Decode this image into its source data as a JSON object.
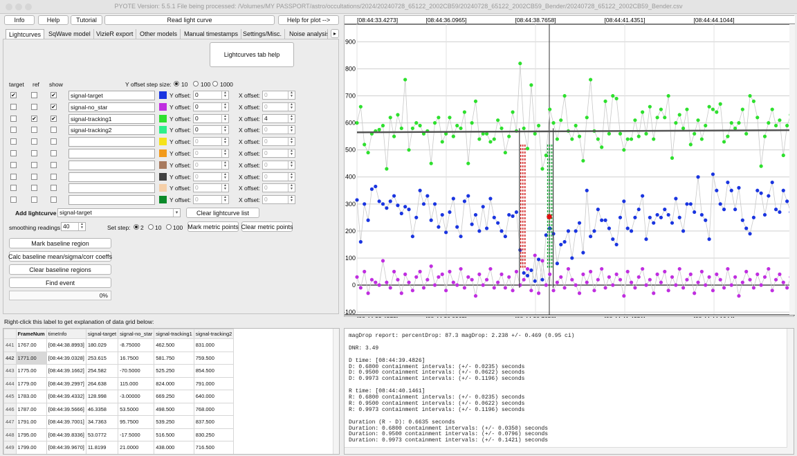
{
  "window": {
    "title": "PYOTE Version: 5.5.1  File being processed: /Volumes/MY PASSPORT/astro/occultations/2024/20240728_65122_2002CB59/20240728_65122_2002CB59_Bender/20240728_65122_2002CB59_Bender.csv"
  },
  "toolbar": {
    "info": "Info",
    "help": "Help",
    "tutorial": "Tutorial",
    "read_light_curve": "Read light curve",
    "help_for_plot": "Help for plot -->"
  },
  "tabs": [
    "Lightcurves",
    "SqWave model",
    "VizieR export",
    "Other models",
    "Manual timestamps",
    "Settings/Misc.",
    "Noise analysis/"
  ],
  "tab_scroll": "▸",
  "lc_tab": {
    "help_button": "Lightcurves tab help",
    "col_target": "target",
    "col_ref": "ref",
    "col_show": "show",
    "y_step_label": "Y offset step size:",
    "y_step_options": [
      "10",
      "100",
      "1000"
    ],
    "y_offset_label": "Y offset:",
    "x_offset_label": "X offset:",
    "rows": [
      {
        "name": "signal-target",
        "color": "#1a35e0",
        "target": "✔",
        "ref": "",
        "show": "✔",
        "y": "0",
        "x": "0"
      },
      {
        "name": "signal-no_star",
        "color": "#c02ee0",
        "target": "",
        "ref": "",
        "show": "✔",
        "y": "0",
        "x": "0"
      },
      {
        "name": "signal-tracking1",
        "color": "#2ee02e",
        "target": "",
        "ref": "✔",
        "show": "✔",
        "y": "0",
        "x": "4"
      },
      {
        "name": "signal-tracking2",
        "color": "#2ef08a",
        "target": "",
        "ref": "",
        "show": "",
        "y": "0",
        "x": "0"
      },
      {
        "name": "",
        "color": "#f5e21a",
        "target": "",
        "ref": "",
        "show": "",
        "y": "0",
        "x": "0"
      },
      {
        "name": "",
        "color": "#f29a1a",
        "target": "",
        "ref": "",
        "show": "",
        "y": "0",
        "x": "0"
      },
      {
        "name": "",
        "color": "#a87a5e",
        "target": "",
        "ref": "",
        "show": "",
        "y": "0",
        "x": "0"
      },
      {
        "name": "",
        "color": "#404040",
        "target": "",
        "ref": "",
        "show": "",
        "y": "0",
        "x": "0"
      },
      {
        "name": "",
        "color": "#f5cfa8",
        "target": "",
        "ref": "",
        "show": "",
        "y": "0",
        "x": "0"
      },
      {
        "name": "",
        "color": "#0a8a2a",
        "target": "",
        "ref": "",
        "show": "",
        "y": "0",
        "x": "0"
      }
    ],
    "add_lightcurve_label": "Add lightcurve",
    "add_lightcurve_value": "signal-target",
    "clear_lightcurve_list": "Clear lightcurve list",
    "smoothing_label": "smoothing readings",
    "smoothing_value": "40",
    "set_step_label": "Set step:",
    "set_step_options": [
      "2",
      "10",
      "100"
    ],
    "mark_metric_points": "Mark metric points",
    "clear_metric_points": "Clear metric points",
    "mark_baseline": "Mark baseline region",
    "calc_baseline": "Calc baseline mean/sigma/corr coeffs",
    "clear_baseline": "Clear baseline regions",
    "find_event": "Find event",
    "progress": "0%"
  },
  "grid_hint": "Right-click this label to get explanation of data grid below:",
  "data_grid": {
    "headers": [
      "FrameNum",
      "timeInfo",
      "signal-target",
      "signal-no_star",
      "signal-tracking1",
      "signal-tracking2"
    ],
    "rows": [
      {
        "n": "441",
        "cells": [
          "1767.00",
          "[08:44:38.8993]",
          "180.029",
          "-8.75000",
          "462.500",
          "831.000"
        ]
      },
      {
        "n": "442",
        "cells": [
          "1771.00",
          "[08:44:39.0328]",
          "253.615",
          "16.7500",
          "581.750",
          "759.500"
        ]
      },
      {
        "n": "443",
        "cells": [
          "1775.00",
          "[08:44:39.1662]",
          "254.582",
          "-70.5000",
          "525.250",
          "854.500"
        ]
      },
      {
        "n": "444",
        "cells": [
          "1779.00",
          "[08:44:39.2997]",
          "264.638",
          "115.000",
          "824.000",
          "791.000"
        ]
      },
      {
        "n": "445",
        "cells": [
          "1783.00",
          "[08:44:39.4332]",
          "128.998",
          "-3.00000",
          "669.250",
          "640.000"
        ]
      },
      {
        "n": "446",
        "cells": [
          "1787.00",
          "[08:44:39.5666]",
          "46.3358",
          "53.5000",
          "498.500",
          "768.000"
        ]
      },
      {
        "n": "447",
        "cells": [
          "1791.00",
          "[08:44:39.7001]",
          "34.7363",
          "95.7500",
          "539.250",
          "837.500"
        ]
      },
      {
        "n": "448",
        "cells": [
          "1795.00",
          "[08:44:39.8336]",
          "53.0772",
          "-17.5000",
          "516.500",
          "830.250"
        ]
      },
      {
        "n": "449",
        "cells": [
          "1799.00",
          "[08:44:39.9670]",
          "11.8199",
          "21.0000",
          "438.000",
          "716.500"
        ]
      }
    ]
  },
  "report_lines": [
    "magDrop report: percentDrop: 87.3 magDrop: 2.238 +/- 0.469 (0.95 ci)",
    "",
    "DNR: 3.49",
    "",
    "D time: [08:44:39.4826]",
    "D: 0.6800 containment intervals: (+/- 0.0235) seconds",
    "D: 0.9500 containment intervals: (+/- 0.0622) seconds",
    "D: 0.9973 containment intervals: (+/- 0.1196) seconds",
    "",
    "R time: [08:44:40.1461]",
    "R: 0.6800 containment intervals: (+/- 0.0235) seconds",
    "R: 0.9500 containment intervals: (+/- 0.0622) seconds",
    "R: 0.9973 containment intervals: (+/- 0.1196) seconds",
    "",
    "Duration (R - D): 0.6635 seconds",
    "Duration: 0.6800 containment intervals: (+/- 0.0350) seconds",
    "Duration: 0.9500 containment intervals: (+/- 0.0796) seconds",
    "Duration: 0.9973 containment intervals: (+/- 0.1421) seconds"
  ],
  "chart_data": {
    "type": "scatter",
    "x_tick_labels": [
      "[08:44:33.4273]",
      "[08:44:36.0965]",
      "[08:44:38.7658]",
      "[08:44:41.4351]",
      "[08:44:44.1044]"
    ],
    "y_ticks": [
      -100,
      0,
      100,
      200,
      300,
      400,
      500,
      600,
      700,
      800,
      900
    ],
    "ylim": [
      -110,
      965
    ],
    "grid": true,
    "colors": {
      "target": "#1a35e0",
      "no_star": "#c02ee0",
      "tracking1": "#2ee02e",
      "baseline": "#555555",
      "d_marker": "#d01010",
      "r_marker": "#10a030"
    },
    "series": [
      {
        "name": "signal-target",
        "values": [
          315,
          160,
          300,
          240,
          355,
          365,
          310,
          300,
          285,
          310,
          330,
          295,
          265,
          290,
          280,
          180,
          250,
          350,
          300,
          330,
          240,
          300,
          215,
          260,
          195,
          270,
          320,
          215,
          180,
          310,
          330,
          225,
          260,
          200,
          290,
          210,
          320,
          250,
          230,
          200,
          180,
          260,
          255,
          270,
          130,
          45,
          35,
          55,
          15,
          95,
          20,
          185,
          210,
          190,
          80,
          150,
          160,
          200,
          100,
          200,
          230,
          120,
          350,
          180,
          200,
          280,
          240,
          240,
          210,
          170,
          150,
          250,
          310,
          210,
          200,
          250,
          280,
          330,
          170,
          250,
          230,
          260,
          250,
          280,
          260,
          230,
          320,
          250,
          200,
          300,
          300,
          270,
          400,
          260,
          240,
          170,
          410,
          350,
          300,
          280,
          380,
          350,
          280,
          360,
          240,
          210,
          190,
          250,
          350,
          340,
          260,
          330,
          380,
          280,
          270,
          350,
          310,
          270
        ]
      },
      {
        "name": "signal-no_star",
        "values": [
          30,
          -10,
          50,
          -30,
          20,
          10,
          0,
          90,
          10,
          -10,
          50,
          20,
          -30,
          40,
          10,
          -20,
          30,
          50,
          -10,
          20,
          70,
          0,
          30,
          40,
          -20,
          50,
          10,
          0,
          60,
          -10,
          30,
          20,
          -40,
          40,
          0,
          20,
          60,
          -10,
          10,
          40,
          -10,
          30,
          -20,
          50,
          0,
          20,
          60,
          -20,
          110,
          -30,
          90,
          0,
          40,
          -20,
          10,
          30,
          -10,
          60,
          20,
          0,
          -30,
          40,
          10,
          50,
          -20,
          20,
          60,
          -10,
          30,
          0,
          40,
          20,
          -40,
          50,
          10,
          -10,
          30,
          60,
          0,
          20,
          -30,
          40,
          10,
          50,
          -20,
          30,
          0,
          60,
          -10,
          20,
          40,
          -30,
          10,
          50,
          0,
          30,
          -20,
          40,
          20,
          -10,
          60,
          0,
          30,
          -40,
          10,
          50,
          20,
          -10,
          40,
          0,
          30,
          60,
          -20,
          20,
          40,
          10,
          -10,
          30
        ]
      },
      {
        "name": "signal-tracking1",
        "values": [
          600,
          660,
          520,
          490,
          560,
          570,
          575,
          590,
          430,
          620,
          550,
          630,
          580,
          760,
          500,
          580,
          600,
          590,
          560,
          570,
          450,
          600,
          620,
          530,
          560,
          620,
          550,
          590,
          580,
          640,
          450,
          600,
          680,
          540,
          560,
          560,
          530,
          540,
          610,
          580,
          490,
          550,
          640,
          570,
          820,
          580,
          505,
          740,
          560,
          590,
          430,
          480,
          650,
          600,
          540,
          610,
          700,
          570,
          540,
          590,
          550,
          460,
          620,
          760,
          570,
          540,
          510,
          680,
          560,
          700,
          690,
          560,
          500,
          540,
          540,
          610,
          550,
          640,
          560,
          660,
          540,
          620,
          650,
          620,
          700,
          470,
          600,
          630,
          580,
          650,
          520,
          560,
          610,
          540,
          590,
          660,
          650,
          640,
          670,
          530,
          550,
          600,
          580,
          600,
          650,
          560,
          700,
          680,
          620,
          440,
          550,
          600,
          650,
          590,
          610,
          480,
          590,
          630
        ]
      },
      {
        "name": "baseline",
        "values": [
          565,
          573
        ]
      }
    ],
    "events": {
      "d_frame": 44,
      "r_frame": 49
    }
  }
}
